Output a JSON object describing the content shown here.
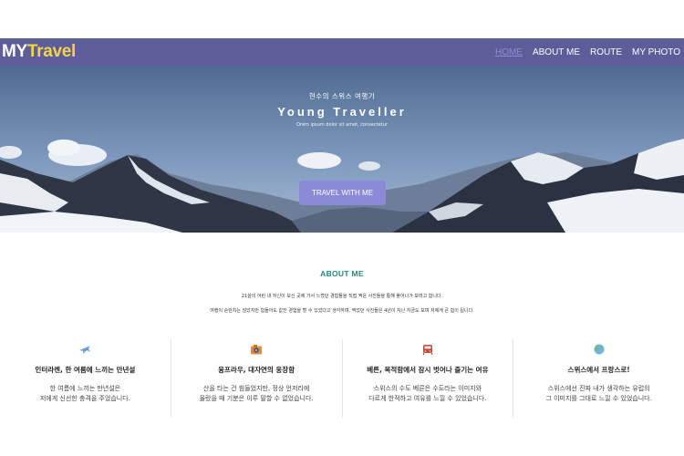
{
  "brand": {
    "part1": "MY",
    "part2": "Travel"
  },
  "nav": {
    "items": [
      "HOME",
      "ABOUT ME",
      "ROUTE",
      "MY PHOTO"
    ]
  },
  "hero": {
    "subtitle": "현수의 스위스 여행기",
    "title": "Young Traveller",
    "lorem": "Orem ipsum dolor sit amet, consectetur",
    "button": "TRAVEL WITH ME"
  },
  "about": {
    "title": "ABOUT ME",
    "p1": "21살의 어린 내 자신이 보신 곳에 가서 느꼈던 경험들을 직접 찍은 사진들을 통해 풀어나가 보려고 합니다.",
    "p2": "여행이 순탄치는 않았지만 힘들어도 값진 경험을 할 수 있었다고 생각하며, 찍었던 사진들은 4년이 지난 지금도 보며 저에게 큰 힘이 됩니다."
  },
  "cards": [
    {
      "icon": "airplane-icon",
      "title": "인터라켄, 한 여름에 느끼는 만년설",
      "line1": "한 여름에 느끼는 만년설은",
      "line2": "저에게 신선한 충격을 주었습니다."
    },
    {
      "icon": "camera-icon",
      "title": "융프라우, 대자연의 웅장함",
      "line1": "산을 타는 건 힘들었지만, 정상 언저리에",
      "line2": "올랐을 때 기분은 이루 말할 수 없었습니다."
    },
    {
      "icon": "train-icon",
      "title": "베른, 복적함에서 잠시 벗어나 즐기는 여유",
      "line1": "스위스의 수도 베른은 수도라는 이미지와",
      "line2": "다르게 한적하고 여유를 느낄 수 있었습니다."
    },
    {
      "icon": "globe-icon",
      "title": "스위스에서 프랑스로!",
      "line1": "스위스에선 진짜 내가 생각하는 유럽의",
      "line2": "그 이미지를 그대로 느낄 수 있었습니다."
    }
  ],
  "colors": {
    "navbar": "#5d5d9a",
    "brand_accent": "#f3d34a",
    "nav_active": "#8f8bd6",
    "about_title": "#1e8a7d",
    "hero_button": "#8b8ad6"
  }
}
